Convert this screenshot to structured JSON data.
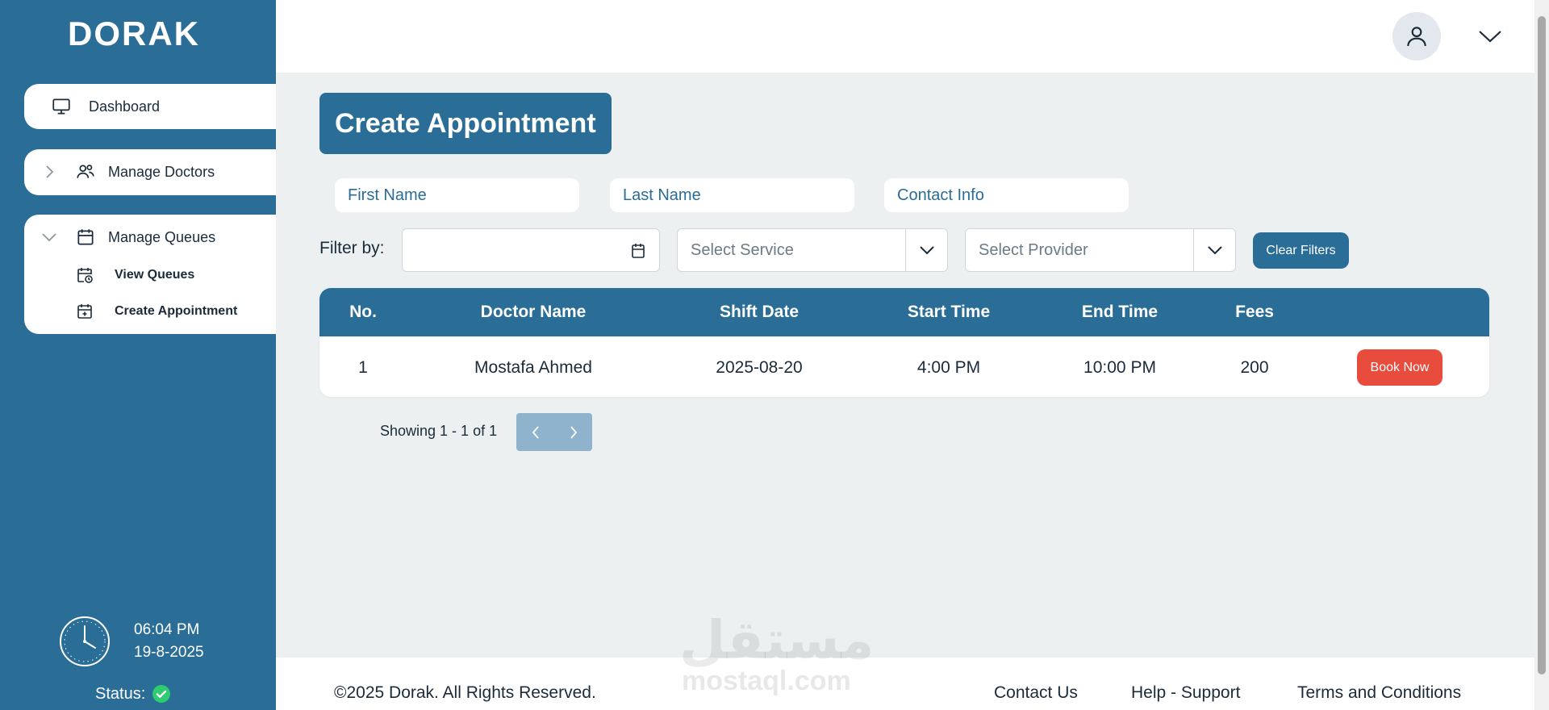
{
  "brand": {
    "logo_text": "DORAK"
  },
  "sidebar": {
    "items": [
      {
        "label": "Dashboard",
        "icon": "monitor-icon"
      },
      {
        "label": "Manage Doctors",
        "icon": "users-icon",
        "expanded": false
      },
      {
        "label": "Manage Queues",
        "icon": "calendar-icon",
        "expanded": true,
        "children": [
          {
            "label": "View Queues",
            "icon": "calendar-clock-icon"
          },
          {
            "label": "Create Appointment",
            "icon": "calendar-plus-icon"
          }
        ]
      }
    ],
    "clock": {
      "time": "06:04 PM",
      "date": "19-8-2025"
    },
    "status": {
      "label": "Status:",
      "state": "online",
      "color": "#2ecc71"
    }
  },
  "header": {
    "avatar_icon": "user-icon",
    "menu_icon": "chevron-down-icon"
  },
  "main": {
    "title": "Create Appointment",
    "inputs": {
      "first_name": {
        "placeholder": "First Name",
        "value": ""
      },
      "last_name": {
        "placeholder": "Last Name",
        "value": ""
      },
      "contact": {
        "placeholder": "Contact Info",
        "value": ""
      }
    },
    "filters": {
      "label": "Filter by:",
      "date_value": "",
      "service": {
        "selected": "Select Service"
      },
      "provider": {
        "selected": "Select Provider"
      },
      "clear_label": "Clear Filters"
    },
    "table": {
      "columns": [
        "No.",
        "Doctor Name",
        "Shift Date",
        "Start Time",
        "End Time",
        "Fees"
      ],
      "rows": [
        {
          "no": "1",
          "doctor": "Mostafa Ahmed",
          "date": "2025-08-20",
          "start": "4:00 PM",
          "end": "10:00 PM",
          "fees": "200",
          "action": "Book Now"
        }
      ]
    },
    "pagination": {
      "text": "Showing 1 - 1 of 1"
    }
  },
  "footer": {
    "copyright": "©2025 Dorak. All Rights Reserved.",
    "links": [
      "Contact Us",
      "Help - Support",
      "Terms and Conditions"
    ]
  },
  "watermark": {
    "arabic": "مستقل",
    "latin": "mostaql.com"
  },
  "colors": {
    "primary": "#2a6d96",
    "danger": "#e74c3c",
    "background": "#ecf0f1",
    "pager": "#8fb3cc"
  }
}
